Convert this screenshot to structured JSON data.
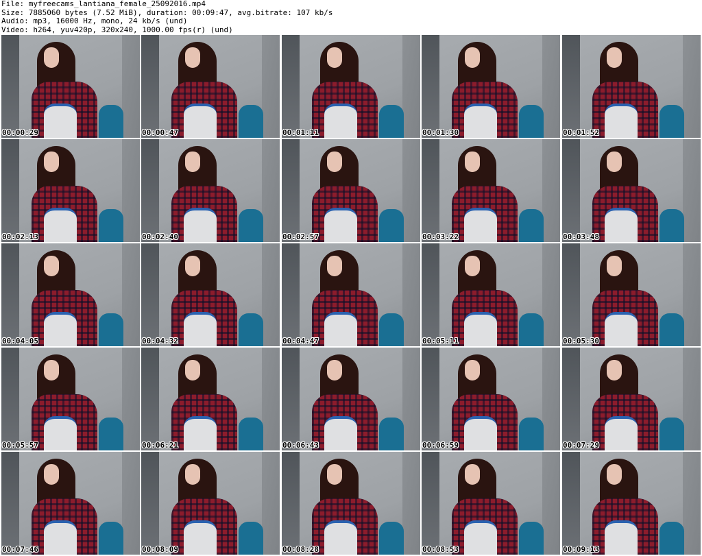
{
  "header": {
    "lines": [
      "File: myfreecams_lantiana_female_25092016.mp4",
      "Size: 7885060 bytes (7.52 MiB), duration: 00:09:47, avg.bitrate: 107 kb/s",
      "Audio: mp3, 16000 Hz, mono, 24 kb/s (und)",
      "Video: h264, yuv420p, 320x240, 1000.00 fps(r) (und)"
    ]
  },
  "grid": {
    "columns": 5,
    "thumbnails": [
      {
        "time": "00:00:29"
      },
      {
        "time": "00:00:47"
      },
      {
        "time": "00:01:11"
      },
      {
        "time": "00:01:30"
      },
      {
        "time": "00:01:52"
      },
      {
        "time": "00:02:13"
      },
      {
        "time": "00:02:40"
      },
      {
        "time": "00:02:57"
      },
      {
        "time": "00:03:22"
      },
      {
        "time": "00:03:48"
      },
      {
        "time": "00:04:05"
      },
      {
        "time": "00:04:32"
      },
      {
        "time": "00:04:47"
      },
      {
        "time": "00:05:11"
      },
      {
        "time": "00:05:30"
      },
      {
        "time": "00:05:57"
      },
      {
        "time": "00:06:21"
      },
      {
        "time": "00:06:43"
      },
      {
        "time": "00:06:59"
      },
      {
        "time": "00:07:29"
      },
      {
        "time": "00:07:46"
      },
      {
        "time": "00:08:09"
      },
      {
        "time": "00:08:28"
      },
      {
        "time": "00:08:53"
      },
      {
        "time": "00:09:13"
      }
    ]
  },
  "colors": {
    "background": "#ffffff",
    "text": "#000000",
    "shirt": "#8c1c2c",
    "chair": "#1a6f93"
  }
}
